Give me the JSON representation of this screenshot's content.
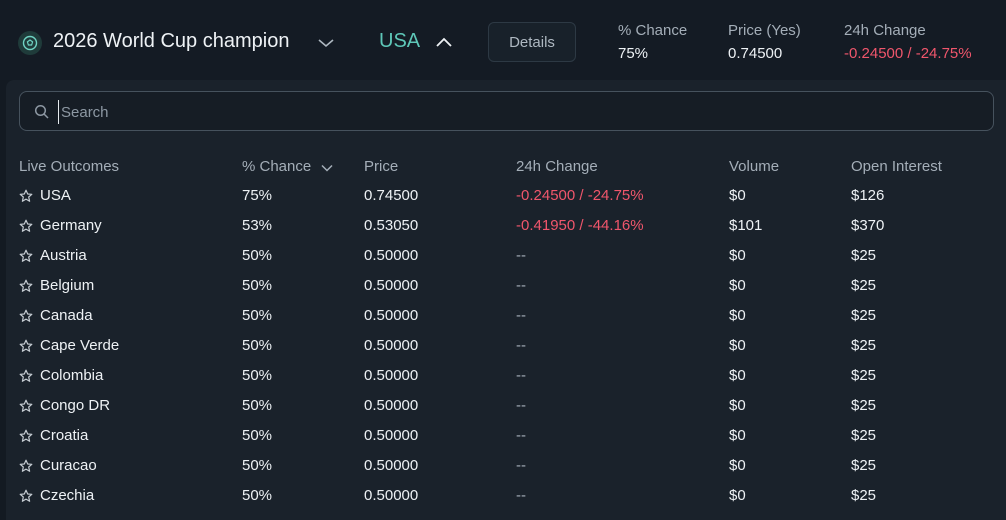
{
  "header": {
    "market_title": "2026 World Cup champion",
    "selected_outcome": "USA",
    "details_label": "Details",
    "stats": [
      {
        "label": "% Chance",
        "value": "75%",
        "negative": false
      },
      {
        "label": "Price (Yes)",
        "value": "0.74500",
        "negative": false
      },
      {
        "label": "24h Change",
        "value": "-0.24500 / -24.75%",
        "negative": true
      }
    ]
  },
  "search": {
    "placeholder": "Search",
    "value": ""
  },
  "table": {
    "columns": [
      "Live Outcomes",
      "% Chance",
      "Price",
      "24h Change",
      "Volume",
      "Open Interest"
    ],
    "sorted_column": "% Chance",
    "rows": [
      {
        "name": "USA",
        "chance": "75%",
        "price": "0.74500",
        "change": "-0.24500 / -24.75%",
        "volume": "$0",
        "open_interest": "$126"
      },
      {
        "name": "Germany",
        "chance": "53%",
        "price": "0.53050",
        "change": "-0.41950 / -44.16%",
        "volume": "$101",
        "open_interest": "$370"
      },
      {
        "name": "Austria",
        "chance": "50%",
        "price": "0.50000",
        "change": "--",
        "volume": "$0",
        "open_interest": "$25"
      },
      {
        "name": "Belgium",
        "chance": "50%",
        "price": "0.50000",
        "change": "--",
        "volume": "$0",
        "open_interest": "$25"
      },
      {
        "name": "Canada",
        "chance": "50%",
        "price": "0.50000",
        "change": "--",
        "volume": "$0",
        "open_interest": "$25"
      },
      {
        "name": "Cape Verde",
        "chance": "50%",
        "price": "0.50000",
        "change": "--",
        "volume": "$0",
        "open_interest": "$25"
      },
      {
        "name": "Colombia",
        "chance": "50%",
        "price": "0.50000",
        "change": "--",
        "volume": "$0",
        "open_interest": "$25"
      },
      {
        "name": "Congo DR",
        "chance": "50%",
        "price": "0.50000",
        "change": "--",
        "volume": "$0",
        "open_interest": "$25"
      },
      {
        "name": "Croatia",
        "chance": "50%",
        "price": "0.50000",
        "change": "--",
        "volume": "$0",
        "open_interest": "$25"
      },
      {
        "name": "Curacao",
        "chance": "50%",
        "price": "0.50000",
        "change": "--",
        "volume": "$0",
        "open_interest": "$25"
      },
      {
        "name": "Czechia",
        "chance": "50%",
        "price": "0.50000",
        "change": "--",
        "volume": "$0",
        "open_interest": "$25"
      }
    ]
  },
  "colors": {
    "background": "#131a22",
    "panel": "#1a222b",
    "accent_teal": "#5ec7b8",
    "negative_red": "#f0566c",
    "muted_text": "#a4aeb8"
  },
  "icons": {
    "market": "soccer-ball-icon",
    "title_dropdown": "chevron-down-icon",
    "outcome_dropdown": "chevron-up-icon",
    "search": "search-icon",
    "favorite": "star-icon",
    "sort": "chevron-down-icon"
  }
}
